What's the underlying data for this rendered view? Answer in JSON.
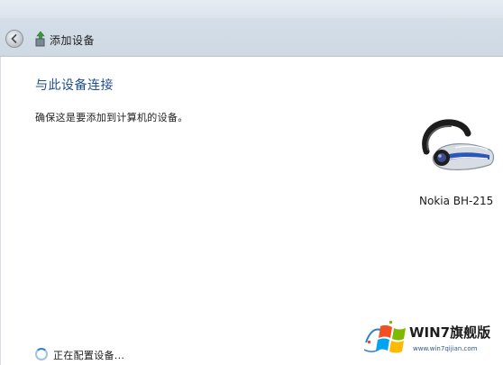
{
  "window": {
    "title": "添加设备"
  },
  "main": {
    "heading": "与此设备连接",
    "description": "确保这是要添加到计算机的设备。"
  },
  "device": {
    "name": "Nokia BH-215",
    "icon": "bluetooth-headset-icon"
  },
  "status": {
    "text": "正在配置设备..."
  },
  "watermark": {
    "title": "WIN7旗舰版",
    "url": "www.win7qijian.com"
  },
  "colors": {
    "heading": "#1f4e8c",
    "titlebar": "#d3dde7"
  }
}
